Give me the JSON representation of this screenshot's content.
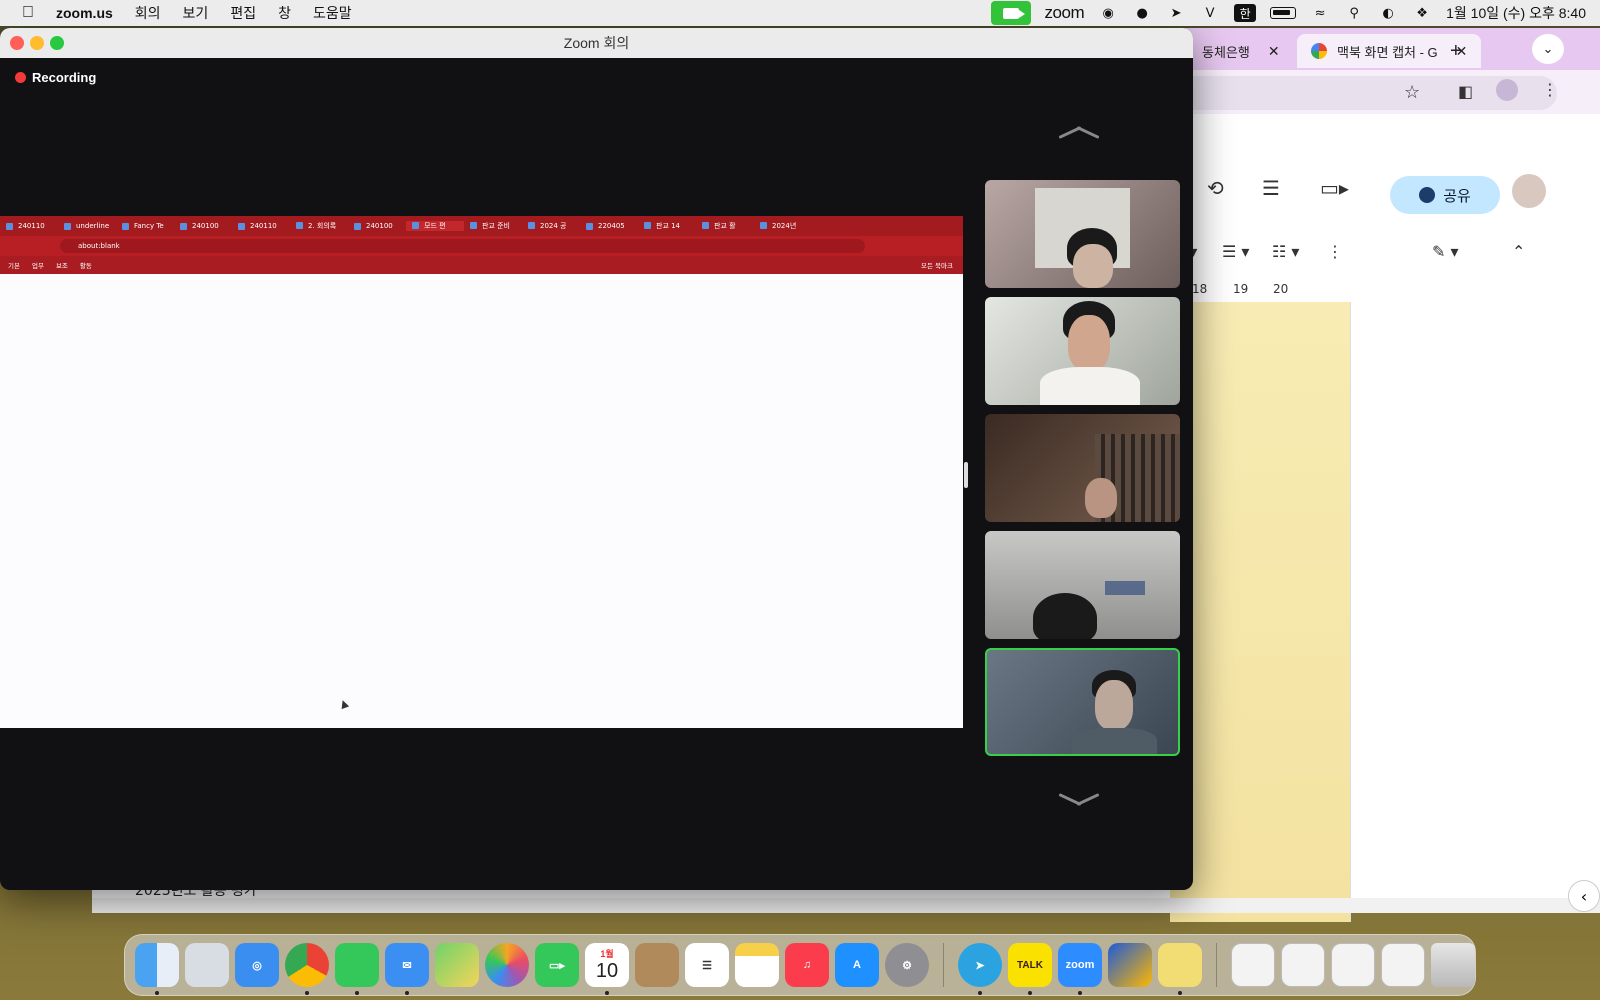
{
  "menubar": {
    "app_name": "zoom.us",
    "items": [
      "회의",
      "보기",
      "편집",
      "창",
      "도움말"
    ],
    "zoom_text": "zoom",
    "input_method": "한",
    "clock": "1월 10일 (수) 오후 8:40"
  },
  "zoom_window": {
    "title": "Zoom 회의",
    "recording_label": "Recording",
    "shared_screen": {
      "tabs": [
        "240110",
        "underline",
        "Fancy Te",
        "240100",
        "240110",
        "2. 회의록",
        "240100",
        "모드 편",
        "판교 준비",
        "2024 공",
        "220405",
        "판교 14",
        "판교 활",
        "2024년"
      ],
      "address": "about:blank",
      "bookmarks": [
        "기본",
        "업무",
        "보조",
        "활동"
      ],
      "bookmarks_right": "모든 북마크"
    }
  },
  "chrome_window": {
    "tab1_label": "동체은행",
    "tab2_label": "맥북 화면 캡처 - G",
    "share_label": "공유",
    "ruler": [
      "18",
      "19",
      "20"
    ],
    "doc_heading": "2023년도 활동 평가"
  },
  "colors": {
    "zoom_green": "#37d04a",
    "recording_red": "#f23a3a",
    "shared_tab_red": "#a31a1f",
    "share_button": "#c2e7ff"
  },
  "dock": {
    "kakao_label": "TALK",
    "zoom_label": "zoom",
    "calendar_month": "1월",
    "calendar_day": "10"
  }
}
